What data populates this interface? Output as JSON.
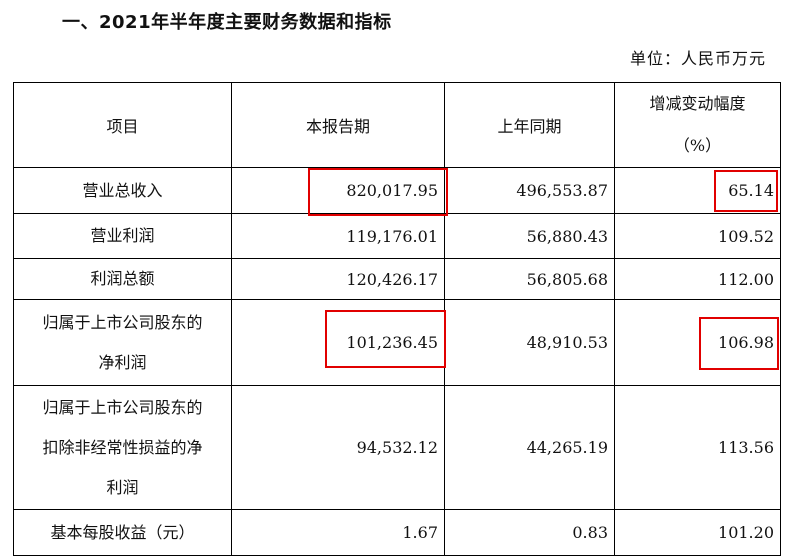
{
  "title": "一、2021年半年度主要财务数据和指标",
  "unit": "单位：人民币万元",
  "table": {
    "headers": [
      "项目",
      "本报告期",
      "上年同期",
      "增减变动幅度",
      "（%）"
    ],
    "rows": [
      {
        "item": "营业总收入",
        "current": "820,017.95",
        "previous": "496,553.87",
        "change": "65.14"
      },
      {
        "item": "营业利润",
        "current": "119,176.01",
        "previous": "56,880.43",
        "change": "109.52"
      },
      {
        "item": "利润总额",
        "current": "120,426.17",
        "previous": "56,805.68",
        "change": "112.00"
      },
      {
        "item_lines": [
          "归属于上市公司股东的",
          "净利润"
        ],
        "current": "101,236.45",
        "previous": "48,910.53",
        "change": "106.98"
      },
      {
        "item_lines": [
          "归属于上市公司股东的",
          "扣除非经常性损益的净",
          "利润"
        ],
        "current": "94,532.12",
        "previous": "44,265.19",
        "change": "113.56"
      },
      {
        "item": "基本每股收益（元）",
        "current": "1.67",
        "previous": "0.83",
        "change": "101.20"
      }
    ]
  },
  "highlight_color": "#e10000"
}
